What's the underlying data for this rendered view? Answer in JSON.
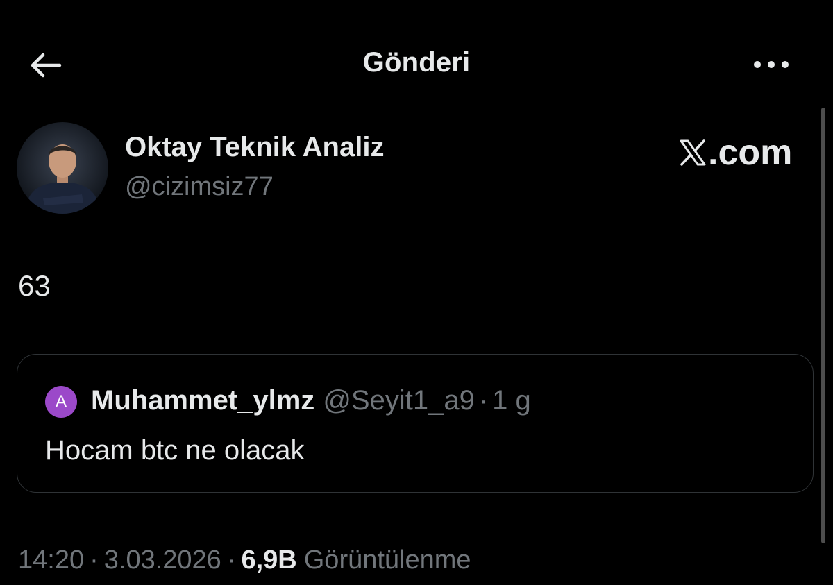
{
  "header": {
    "title": "Gönderi",
    "back_icon": "arrow-left-icon",
    "more_icon": "more-horizontal-icon"
  },
  "author": {
    "name": "Oktay Teknik Analiz",
    "handle": "@cizimsiz77"
  },
  "brand": {
    "text": ".com",
    "icon": "x-logo-icon"
  },
  "tweet": {
    "text": "63"
  },
  "quote": {
    "avatar_letter": "A",
    "avatar_color": "#9b49c9",
    "name": "Muhammet_ylmz",
    "handle": "@Seyit1_a9",
    "separator": "·",
    "time": "1 g",
    "text": "Hocam btc ne olacak"
  },
  "meta": {
    "time": "14:20",
    "separator": "·",
    "date": "3.03.2026",
    "views_count": "6,9B",
    "views_label": "Görüntülenme"
  },
  "colors": {
    "background": "#000000",
    "primary_text": "#e7e9ea",
    "secondary_text": "#71767b",
    "border": "#2f3336"
  }
}
